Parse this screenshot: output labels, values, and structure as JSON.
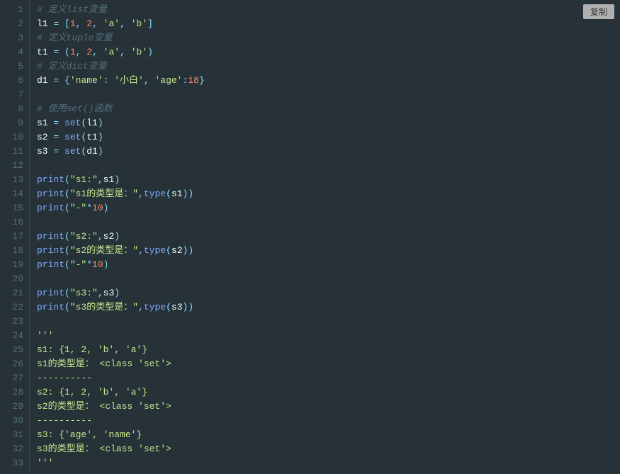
{
  "copy_button_label": "复制",
  "line_count": 33,
  "lines": {
    "l1_comment": "# 定义list变量",
    "l2_var": "l1",
    "l2_eq": " = ",
    "l2_b1": "[",
    "l2_n1": "1",
    "l2_c1": ", ",
    "l2_n2": "2",
    "l2_c2": ", ",
    "l2_s1": "'a'",
    "l2_c3": ", ",
    "l2_s2": "'b'",
    "l2_b2": "]",
    "l3_comment": "# 定义tuple变量",
    "l4_var": "t1",
    "l4_eq": " = ",
    "l4_p1": "(",
    "l4_n1": "1",
    "l4_c1": ", ",
    "l4_n2": "2",
    "l4_c2": ", ",
    "l4_s1": "'a'",
    "l4_c3": ", ",
    "l4_s2": "'b'",
    "l4_p2": ")",
    "l5_comment": "# 定义dict变量",
    "l6_var": "d1",
    "l6_eq": " = ",
    "l6_b1": "{",
    "l6_k1": "'name'",
    "l6_c1": ": ",
    "l6_v1": "'小白'",
    "l6_c2": ", ",
    "l6_k2": "'age'",
    "l6_c3": ":",
    "l6_v2": "18",
    "l6_b2": "}",
    "l8_comment": "# 使用set()函数",
    "l9_var": "s1",
    "l9_eq": " = ",
    "l9_fn": "set",
    "l9_p1": "(",
    "l9_arg": "l1",
    "l9_p2": ")",
    "l10_var": "s2",
    "l10_eq": " = ",
    "l10_fn": "set",
    "l10_p1": "(",
    "l10_arg": "t1",
    "l10_p2": ")",
    "l11_var": "s3",
    "l11_eq": " = ",
    "l11_fn": "set",
    "l11_p1": "(",
    "l11_arg": "d1",
    "l11_p2": ")",
    "l13_fn": "print",
    "l13_p1": "(",
    "l13_s": "\"s1:\"",
    "l13_c": ",",
    "l13_arg": "s1",
    "l13_p2": ")",
    "l14_fn": "print",
    "l14_p1": "(",
    "l14_s": "\"s1的类型是：\"",
    "l14_c": ",",
    "l14_fn2": "type",
    "l14_p3": "(",
    "l14_arg": "s1",
    "l14_p4": ")",
    "l14_p5": ")",
    "l15_fn": "print",
    "l15_p1": "(",
    "l15_s": "\"-\"",
    "l15_op": "*",
    "l15_n": "10",
    "l15_p2": ")",
    "l17_fn": "print",
    "l17_p1": "(",
    "l17_s": "\"s2:\"",
    "l17_c": ",",
    "l17_arg": "s2",
    "l17_p2": ")",
    "l18_fn": "print",
    "l18_p1": "(",
    "l18_s": "\"s2的类型是：\"",
    "l18_c": ",",
    "l18_fn2": "type",
    "l18_p3": "(",
    "l18_arg": "s2",
    "l18_p4": ")",
    "l18_p5": ")",
    "l19_fn": "print",
    "l19_p1": "(",
    "l19_s": "\"-\"",
    "l19_op": "*",
    "l19_n": "10",
    "l19_p2": ")",
    "l21_fn": "print",
    "l21_p1": "(",
    "l21_s": "\"s3:\"",
    "l21_c": ",",
    "l21_arg": "s3",
    "l21_p2": ")",
    "l22_fn": "print",
    "l22_p1": "(",
    "l22_s": "\"s3的类型是：\"",
    "l22_c": ",",
    "l22_fn2": "type",
    "l22_p3": "(",
    "l22_arg": "s3",
    "l22_p4": ")",
    "l22_p5": ")",
    "l24_doc": "'''",
    "l25_doc": "s1: {1, 2, 'b', 'a'}",
    "l26_doc": "s1的类型是： <class 'set'>",
    "l27_doc": "----------",
    "l28_doc": "s2: {1, 2, 'b', 'a'}",
    "l29_doc": "s2的类型是： <class 'set'>",
    "l30_doc": "----------",
    "l31_doc": "s3: {'age', 'name'}",
    "l32_doc": "s3的类型是： <class 'set'>",
    "l33_doc": "'''"
  }
}
